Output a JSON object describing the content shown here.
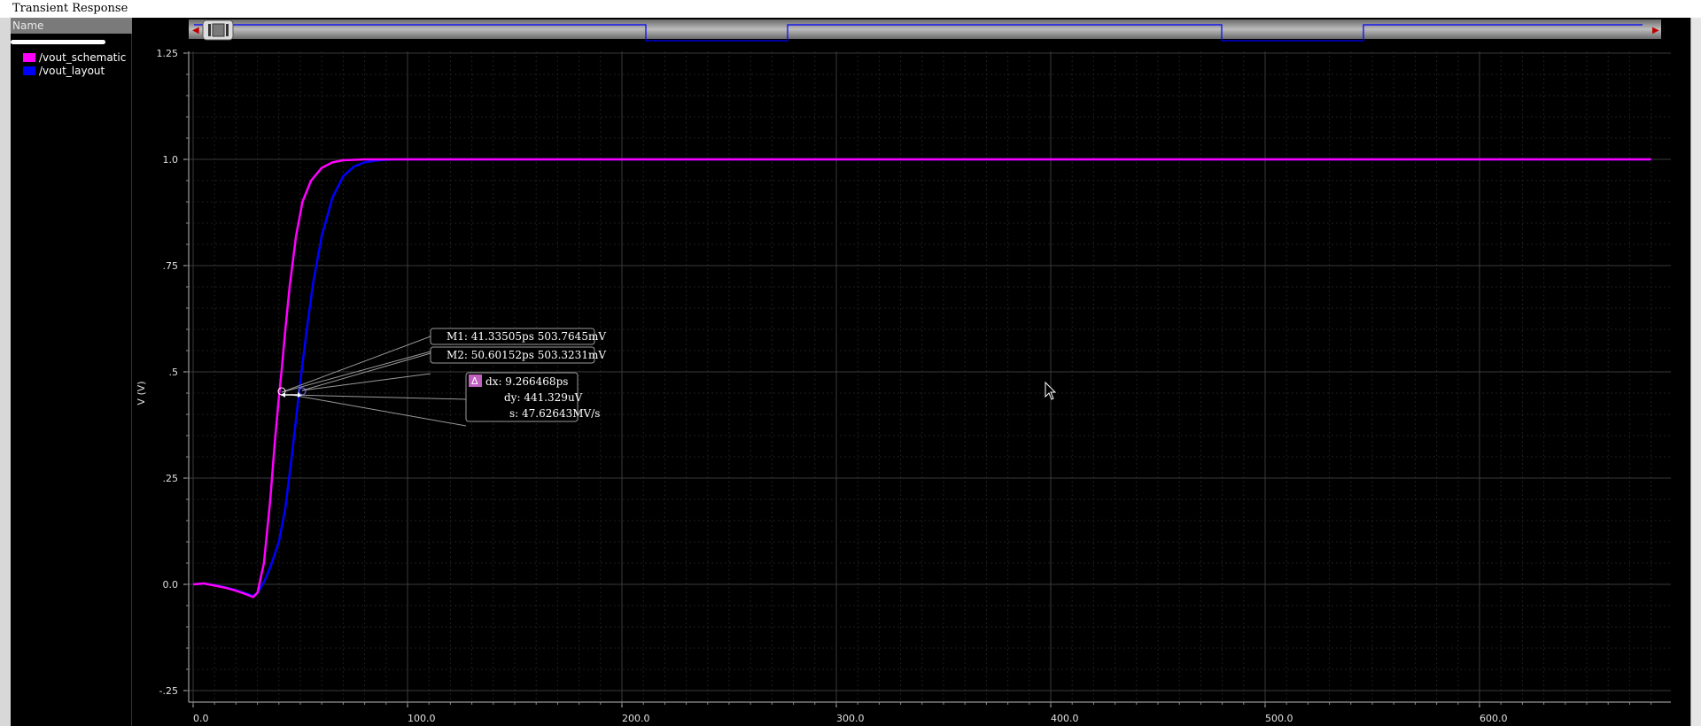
{
  "window": {
    "title": "Transient Response"
  },
  "legend": {
    "header": "Name",
    "items": [
      {
        "label": "/vout_schematic",
        "color": "#ff00ff"
      },
      {
        "label": "/vout_layout",
        "color": "#0000ff"
      }
    ]
  },
  "markers": {
    "m1": "M1: 41.33505ps 503.7645mV",
    "m2": "M2: 50.60152ps 503.3231mV",
    "delta_icon": "Δ",
    "dx": "dx: 9.266468ps",
    "dy": "dy: 441.329uV",
    "s": "s: 47.62643MV/s"
  },
  "overview": {
    "left_arrow": "◀",
    "right_arrow": "▶"
  },
  "chart_data": {
    "type": "line",
    "ylabel": "V (V)",
    "xlabel": "",
    "xlim": [
      0,
      680
    ],
    "ylim": [
      -0.25,
      1.25
    ],
    "y_ticks": [
      -0.25,
      0.0,
      0.25,
      0.5,
      0.75,
      1.0,
      1.25
    ],
    "y_tick_labels": [
      "-.25",
      "0.0",
      ".25",
      ".5",
      ".75",
      "1.0",
      "1.25"
    ],
    "x_ticks": [
      0,
      100,
      200,
      300,
      400,
      500,
      600
    ],
    "x_tick_labels": [
      "0.0",
      "100.0",
      "200.0",
      "300.0",
      "400.0",
      "500.0",
      "600.0"
    ],
    "grid": true,
    "series": [
      {
        "name": "/vout_schematic",
        "color": "#ff00ff",
        "x": [
          0,
          5,
          10,
          15,
          20,
          25,
          28,
          30,
          33,
          36,
          38,
          40,
          41.3,
          43,
          45,
          48,
          51,
          55,
          60,
          65,
          70,
          75,
          80,
          90,
          100,
          680
        ],
        "y": [
          0.0,
          0.002,
          -0.003,
          -0.008,
          -0.015,
          -0.024,
          -0.03,
          -0.02,
          0.05,
          0.2,
          0.33,
          0.44,
          0.504,
          0.6,
          0.7,
          0.82,
          0.9,
          0.95,
          0.98,
          0.993,
          0.998,
          0.999,
          1.0,
          1.0,
          1.0,
          1.0
        ]
      },
      {
        "name": "/vout_layout",
        "color": "#0000ff",
        "x": [
          0,
          5,
          10,
          15,
          20,
          25,
          28,
          30,
          33,
          36,
          40,
          43,
          46,
          48,
          50.6,
          53,
          56,
          60,
          65,
          70,
          75,
          80,
          85,
          90,
          95,
          100,
          680
        ],
        "y": [
          0.0,
          0.002,
          -0.002,
          -0.007,
          -0.014,
          -0.022,
          -0.027,
          -0.02,
          0.005,
          0.04,
          0.1,
          0.18,
          0.3,
          0.39,
          0.503,
          0.6,
          0.71,
          0.82,
          0.91,
          0.96,
          0.983,
          0.993,
          0.997,
          0.999,
          1.0,
          1.0,
          1.0
        ]
      }
    ]
  }
}
